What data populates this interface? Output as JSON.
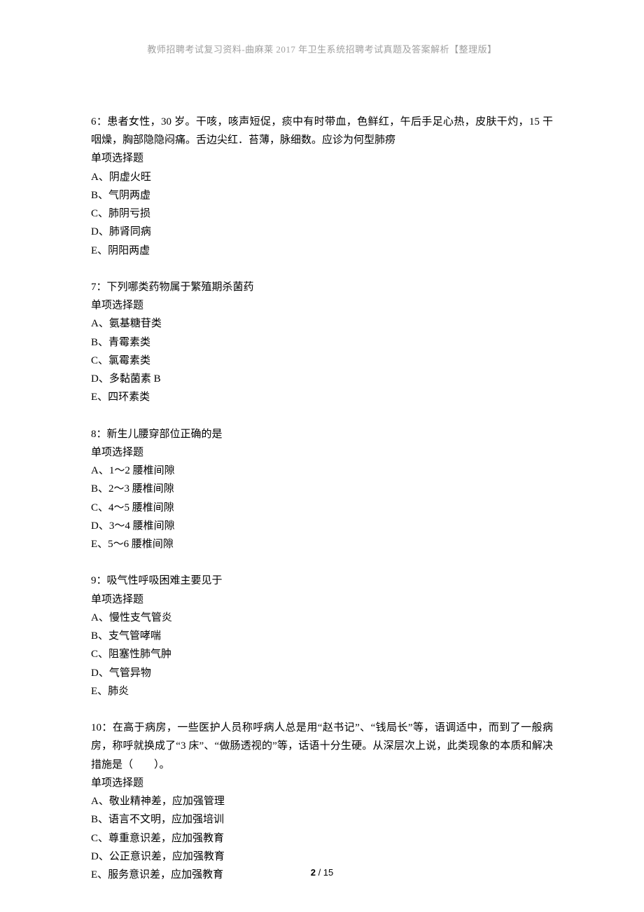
{
  "header": "教师招聘考试复习资料-曲麻莱 2017 年卫生系统招聘考试真题及答案解析【整理版】",
  "questions": [
    {
      "num": "6：",
      "stem": "患者女性，30 岁。干咳，咳声短促，痰中有时带血，色鲜红，午后手足心热，皮肤干灼，15 干咽燥，胸部隐隐闷痛。舌边尖红．苔薄，脉细数。应诊为何型肺痨",
      "qtype": "单项选择题",
      "options": [
        "A、阴虚火旺",
        "B、气阴两虚",
        "C、肺阴亏损",
        "D、肺肾同病",
        "E、阴阳两虚"
      ]
    },
    {
      "num": "7：",
      "stem": "下列哪类药物属于繁殖期杀菌药",
      "qtype": "单项选择题",
      "options": [
        "A、氨基糖苷类",
        "B、青霉素类",
        "C、氯霉素类",
        "D、多黏菌素 B",
        "E、四环素类"
      ]
    },
    {
      "num": "8：",
      "stem": "新生儿腰穿部位正确的是",
      "qtype": "单项选择题",
      "options": [
        "A、1～2 腰椎间隙",
        "B、2～3 腰椎间隙",
        "C、4～5 腰椎间隙",
        "D、3～4 腰椎间隙",
        "E、5～6 腰椎间隙"
      ]
    },
    {
      "num": "9：",
      "stem": "吸气性呼吸困难主要见于",
      "qtype": "单项选择题",
      "options": [
        "A、慢性支气管炎",
        "B、支气管哮喘",
        "C、阻塞性肺气肿",
        "D、气管异物",
        "E、肺炎"
      ]
    },
    {
      "num": "10：",
      "stem": "在高于病房，一些医护人员称呼病人总是用“赵书记”、“钱局长”等，语调适中，而到了一般病房，称呼就换成了“3 床”、“做肠透视的”等，话语十分生硬。从深层次上说，此类现象的本质和解决措施是（　　）。",
      "qtype": "单项选择题",
      "options": [
        "A、敬业精神差，应加强管理",
        "B、语言不文明，应加强培训",
        "C、尊重意识差，应加强教育",
        "D、公正意识差，应加强教育",
        "E、服务意识差，应加强教育"
      ]
    }
  ],
  "footer": {
    "current": "2",
    "sep": " / ",
    "total": "15"
  }
}
